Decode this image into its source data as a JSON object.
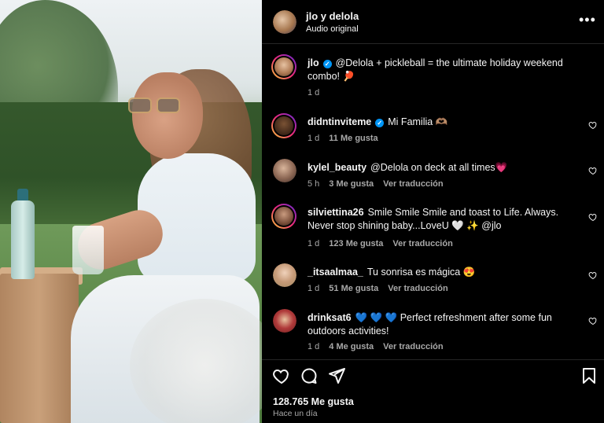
{
  "header": {
    "account_name": "jlo y delola",
    "audio_label": "Audio original",
    "more_icon": "more-horizontal-icon"
  },
  "caption": {
    "username": "jlo",
    "verified": true,
    "text": "@Delola + pickleball = the ultimate holiday weekend combo! 🏓",
    "time": "1 d"
  },
  "comments": [
    {
      "username": "didntinviteme",
      "verified": true,
      "text": "Mi Familia 🫶🏽",
      "time": "1 d",
      "likes": "11 Me gusta",
      "translate": ""
    },
    {
      "username": "kylel_beauty",
      "verified": false,
      "text": "@Delola on deck at all times💗",
      "time": "5 h",
      "likes": "3 Me gusta",
      "translate": "Ver traducción"
    },
    {
      "username": "silviettina26",
      "verified": false,
      "text": "Smile Smile Smile and toast to Life. Always. Never stop shining baby...LoveU 🤍 ✨ @jlo",
      "time": "1 d",
      "likes": "123 Me gusta",
      "translate": "Ver traducción"
    },
    {
      "username": "_itsaalmaa_",
      "verified": false,
      "text": "Tu sonrisa es mágica 😍",
      "time": "1 d",
      "likes": "51 Me gusta",
      "translate": "Ver traducción"
    },
    {
      "username": "drinksat6",
      "verified": false,
      "text": "💙 💙 💙 Perfect refreshment after some fun outdoors activities!",
      "time": "1 d",
      "likes": "4 Me gusta",
      "translate": "Ver traducción"
    }
  ],
  "actions": {
    "like_icon": "heart-icon",
    "comment_icon": "comment-icon",
    "share_icon": "send-icon",
    "save_icon": "bookmark-icon"
  },
  "likes_count": "128.765 Me gusta",
  "posted_time": "Hace un día",
  "colors": {
    "background": "#000000",
    "text": "#f5f5f5",
    "muted": "#a8a8a8",
    "verified": "#0095f6",
    "divider": "#262626"
  }
}
